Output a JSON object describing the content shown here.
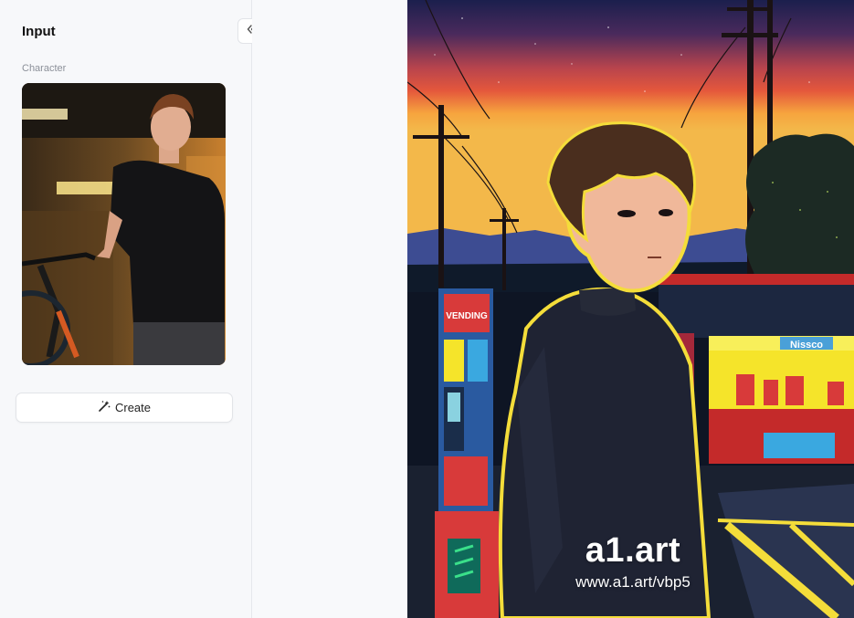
{
  "input_panel": {
    "title": "Input",
    "section_label": "Character",
    "create_label": "Create"
  },
  "collapse_icon": "double-chevron-left-icon",
  "create_icon": "magic-wand-icon",
  "output": {
    "storefront_sign": "Nissco",
    "vending_sign": "VENDING",
    "watermark": {
      "brand": "a1.art",
      "url": "www.a1.art/vbp5"
    }
  },
  "colors": {
    "panel_bg": "#f7f8fa",
    "border": "#e2e4e8",
    "sky_top": "#1b1f4d",
    "sky_mid": "#e4573c",
    "sky_low": "#f6a43e",
    "store_yellow": "#f5e42a",
    "outline_yellow": "#f4dd3a"
  }
}
